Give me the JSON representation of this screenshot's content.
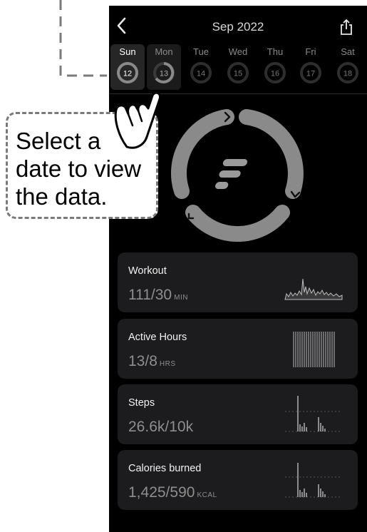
{
  "header": {
    "title": "Sep 2022"
  },
  "icons": {
    "back": "chevron-left-icon",
    "share": "share-icon",
    "logo": "f-logo-icon",
    "hand": "hand-pointer-icon"
  },
  "week": [
    {
      "day": "Sun",
      "date": "12"
    },
    {
      "day": "Mon",
      "date": "13"
    },
    {
      "day": "Tue",
      "date": "14"
    },
    {
      "day": "Wed",
      "date": "15"
    },
    {
      "day": "Thu",
      "date": "16"
    },
    {
      "day": "Fri",
      "date": "17"
    },
    {
      "day": "Sat",
      "date": "18"
    }
  ],
  "selected_day": "Sun",
  "cards": [
    {
      "title": "Workout",
      "value": "111/30",
      "unit": "MIN"
    },
    {
      "title": "Active Hours",
      "value": "13/8",
      "unit": "HRS"
    },
    {
      "title": "Steps",
      "value": "26.6k/10k",
      "unit": ""
    },
    {
      "title": "Calories burned",
      "value": "1,425/590",
      "unit": "KCAL"
    }
  ],
  "callout": {
    "lines": [
      "Select a",
      "date to view",
      "the data."
    ]
  },
  "colors": {
    "background": "#000000",
    "card": "#1c1c1e",
    "ring": "#8a8a8a",
    "callout_border": "#7a7a7a"
  }
}
